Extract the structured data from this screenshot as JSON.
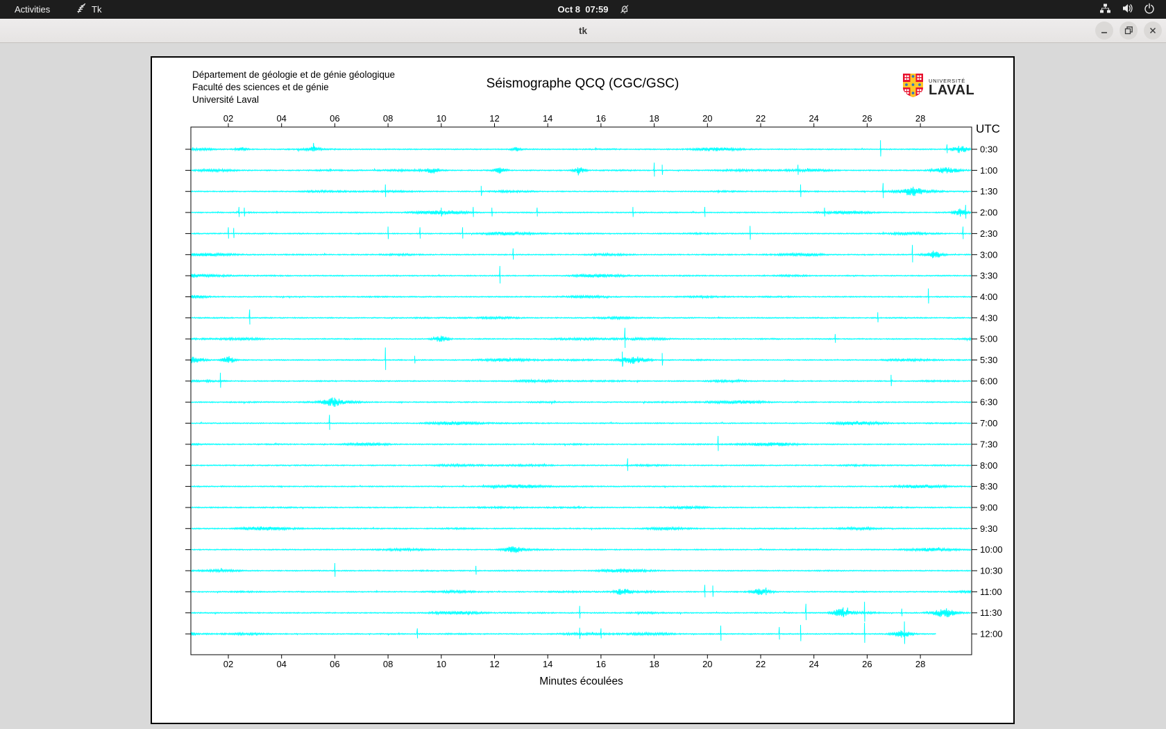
{
  "top_bar": {
    "activities_label": "Activities",
    "app_name": "Tk",
    "clock": "Oct 8  07:59",
    "icons": [
      "tk-feather-icon",
      "bell-slash-icon",
      "network-icon",
      "speaker-icon",
      "power-icon"
    ]
  },
  "window": {
    "title": "tk",
    "controls": [
      "minimize",
      "maximize",
      "close"
    ]
  },
  "seismograph": {
    "header_lines": [
      "Département de géologie et de génie géologique",
      "Faculté des sciences et de génie",
      "Université Laval"
    ],
    "title": "Séismographe QCQ (CGC/GSC)",
    "logo": {
      "small_text": "UNIVERSITÉ",
      "large_text": "LAVAL"
    },
    "chart_data": {
      "type": "line",
      "title": "Séismographe QCQ (CGC/GSC)",
      "xlabel": "Minutes écoulées",
      "ylabel_right": "UTC",
      "ylabel_color": "#ff0000",
      "trace_color": "#00ffff",
      "grid": false,
      "x_range_minutes": [
        0.5,
        30
      ],
      "minutes_per_line": 30,
      "x_ticks": [
        "02",
        "04",
        "06",
        "08",
        "10",
        "12",
        "14",
        "16",
        "18",
        "20",
        "22",
        "24",
        "26",
        "28"
      ],
      "spike_format": "[minute, amplitude, burst_width(optional)]",
      "traces": [
        {
          "utc": "0:30",
          "spikes": [
            [
              2.5,
              3,
              6
            ],
            [
              5.2,
              3,
              5
            ],
            [
              12.8,
              3,
              4
            ],
            [
              26.5,
              13
            ],
            [
              29.0,
              7
            ],
            [
              29.5,
              5,
              8
            ]
          ]
        },
        {
          "utc": "1:00",
          "spikes": [
            [
              9.7,
              4,
              7
            ],
            [
              12.2,
              4,
              6
            ],
            [
              15.2,
              4,
              6
            ],
            [
              18.0,
              11
            ],
            [
              18.3,
              8
            ],
            [
              23.4,
              8
            ],
            [
              29.0,
              4,
              14
            ]
          ]
        },
        {
          "utc": "1:30",
          "spikes": [
            [
              7.9,
              10
            ],
            [
              11.5,
              8
            ],
            [
              23.5,
              10
            ],
            [
              26.6,
              12
            ],
            [
              27.7,
              4,
              9
            ]
          ]
        },
        {
          "utc": "2:00",
          "spikes": [
            [
              2.4,
              8
            ],
            [
              2.6,
              7
            ],
            [
              10.0,
              7
            ],
            [
              11.2,
              8
            ],
            [
              11.9,
              7
            ],
            [
              13.6,
              7
            ],
            [
              17.2,
              8
            ],
            [
              19.9,
              8
            ],
            [
              24.4,
              7
            ],
            [
              29.5,
              5,
              6
            ],
            [
              29.7,
              11
            ]
          ]
        },
        {
          "utc": "2:30",
          "spikes": [
            [
              2.0,
              9
            ],
            [
              2.2,
              8
            ],
            [
              8.0,
              10
            ],
            [
              9.2,
              9
            ],
            [
              10.8,
              9
            ],
            [
              21.6,
              11
            ],
            [
              29.6,
              10
            ]
          ]
        },
        {
          "utc": "3:00",
          "spikes": [
            [
              12.7,
              9
            ],
            [
              27.7,
              14
            ],
            [
              28.5,
              5,
              9
            ]
          ]
        },
        {
          "utc": "3:30",
          "spikes": [
            [
              12.2,
              14
            ]
          ]
        },
        {
          "utc": "4:00",
          "spikes": [
            [
              28.3,
              12
            ]
          ]
        },
        {
          "utc": "4:30",
          "spikes": [
            [
              2.8,
              12
            ],
            [
              26.4,
              8
            ]
          ]
        },
        {
          "utc": "5:00",
          "spikes": [
            [
              10.0,
              4,
              8
            ],
            [
              16.9,
              16
            ],
            [
              24.8,
              7
            ]
          ]
        },
        {
          "utc": "5:30",
          "spikes": [
            [
              0.6,
              4,
              12
            ],
            [
              2.0,
              5,
              6
            ],
            [
              7.9,
              18
            ],
            [
              9.0,
              6
            ],
            [
              16.8,
              12
            ],
            [
              17.2,
              5,
              14
            ],
            [
              18.3,
              10
            ]
          ]
        },
        {
          "utc": "6:00",
          "spikes": [
            [
              1.7,
              12
            ],
            [
              26.9,
              9
            ]
          ]
        },
        {
          "utc": "6:30",
          "spikes": [
            [
              5.9,
              5,
              9
            ]
          ]
        },
        {
          "utc": "7:00",
          "spikes": [
            [
              5.8,
              12
            ]
          ]
        },
        {
          "utc": "7:30",
          "spikes": [
            [
              20.4,
              12
            ]
          ]
        },
        {
          "utc": "8:00",
          "spikes": [
            [
              17.0,
              10
            ]
          ]
        },
        {
          "utc": "8:30",
          "spikes": []
        },
        {
          "utc": "9:00",
          "spikes": []
        },
        {
          "utc": "9:30",
          "spikes": []
        },
        {
          "utc": "10:00",
          "spikes": [
            [
              12.7,
              4,
              9
            ]
          ]
        },
        {
          "utc": "10:30",
          "spikes": [
            [
              6.0,
              11
            ],
            [
              11.3,
              7
            ]
          ]
        },
        {
          "utc": "11:00",
          "spikes": [
            [
              16.8,
              4,
              8
            ],
            [
              19.9,
              10
            ],
            [
              20.2,
              9
            ],
            [
              22.0,
              4,
              9
            ],
            [
              22.2,
              6
            ]
          ]
        },
        {
          "utc": "11:30",
          "spikes": [
            [
              15.2,
              10
            ],
            [
              23.7,
              13
            ],
            [
              25.0,
              5,
              8
            ],
            [
              25.1,
              8
            ],
            [
              25.9,
              16
            ],
            [
              27.3,
              6
            ],
            [
              28.9,
              6,
              12
            ]
          ]
        },
        {
          "utc": "12:00",
          "spikes": [
            [
              0.4,
              5,
              7
            ],
            [
              9.1,
              8
            ],
            [
              15.2,
              9
            ],
            [
              16.0,
              8
            ],
            [
              20.5,
              12
            ],
            [
              22.7,
              10
            ],
            [
              23.5,
              13
            ],
            [
              25.9,
              16
            ],
            [
              27.3,
              5,
              9
            ],
            [
              27.4,
              18
            ]
          ],
          "end_minute": 28.6
        }
      ]
    }
  }
}
